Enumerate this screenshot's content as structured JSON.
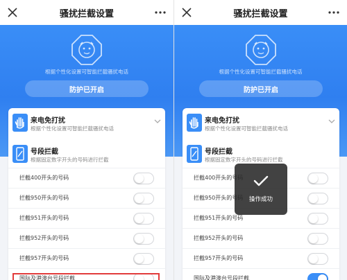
{
  "screens": [
    {
      "title": "骚扰拦截设置",
      "hero": {
        "subtitle": "根据个性化设置可智能拦截骚扰电话",
        "status_button": "防护已开启"
      },
      "section_call": {
        "title": "来电免打扰",
        "desc": "根据个性化设置可智能拦截骚扰电话"
      },
      "section_prefix": {
        "title": "号段拦截",
        "desc": "根据固定数字开头的号码进行拦截"
      },
      "rows": [
        {
          "label": "拦截400开头的号码",
          "on": false
        },
        {
          "label": "拦截950开头的号码",
          "on": false
        },
        {
          "label": "拦截951开头的号码",
          "on": false
        },
        {
          "label": "拦截952开头的号码",
          "on": false
        },
        {
          "label": "拦截957开头的号码",
          "on": false
        },
        {
          "label": "国际及港澳台号段拦截",
          "on": false
        }
      ]
    },
    {
      "title": "骚扰拦截设置",
      "hero": {
        "subtitle": "根据个性化设置可智能拦截骚扰电话",
        "status_button": "防护已开启"
      },
      "section_call": {
        "title": "来电免打扰",
        "desc": "根据个性化设置可智能拦截骚扰电话"
      },
      "section_prefix": {
        "title": "号段拦截",
        "desc": "根据固定数字开头的号码进行拦截"
      },
      "rows": [
        {
          "label": "拦截400开头的号码",
          "on": false
        },
        {
          "label": "拦截950开头的号码",
          "on": false
        },
        {
          "label": "拦截951开头的号码",
          "on": false
        },
        {
          "label": "拦截952开头的号码",
          "on": false
        },
        {
          "label": "拦截957开头的号码",
          "on": false
        },
        {
          "label": "国际及港澳台号段拦截",
          "on": true
        }
      ],
      "toast": "操作成功"
    }
  ],
  "icons": {
    "close": "close-icon",
    "more": "more-dots-icon",
    "logo": "octagon-shield-face-icon",
    "hand": "hand-stop-icon",
    "phone": "phone-icon",
    "chevron": "chevron-down-icon",
    "check": "check-icon"
  },
  "colors": {
    "accent": "#3a8ef7",
    "highlight": "#e23b3b",
    "toast_bg": "#282828"
  }
}
